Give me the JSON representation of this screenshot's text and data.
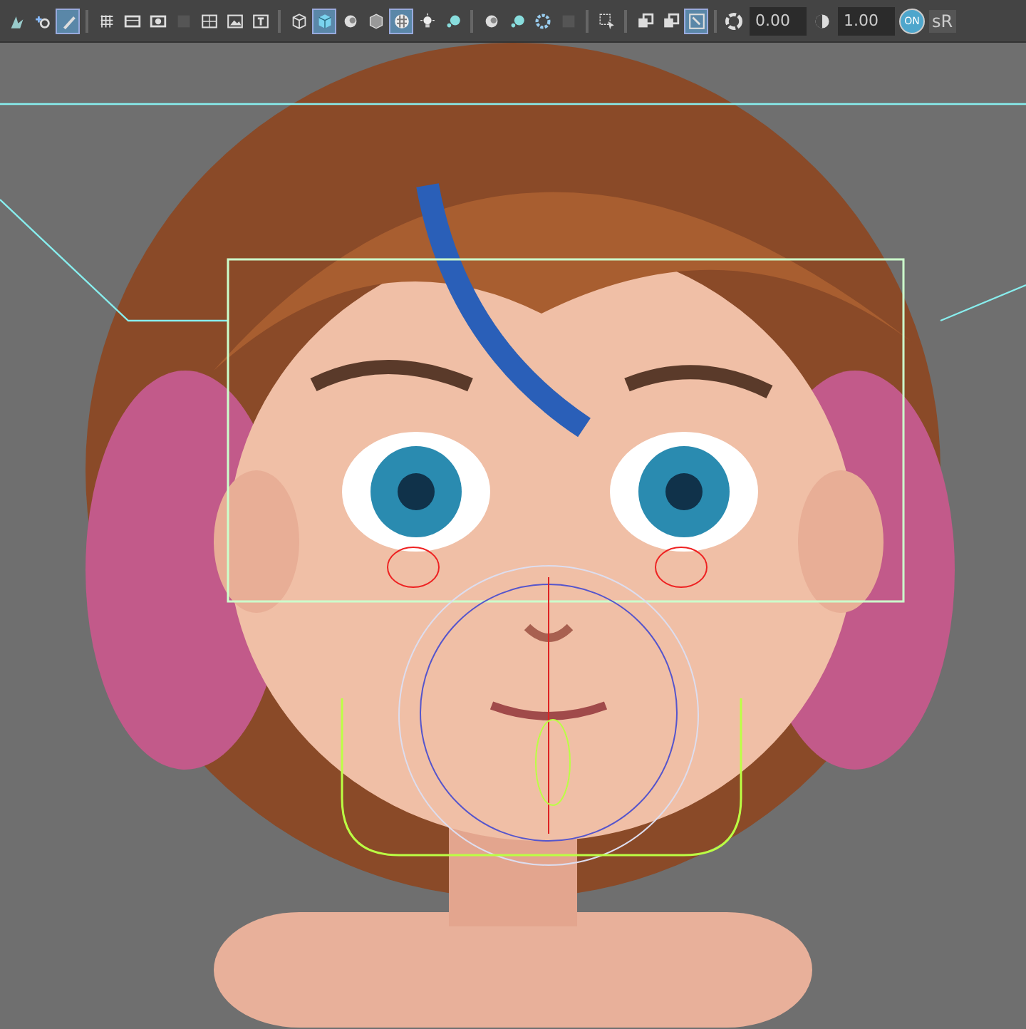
{
  "toolbar": {
    "groups": [
      [
        {
          "kind": "select",
          "selected": false
        },
        {
          "kind": "move",
          "selected": false
        },
        {
          "kind": "pencil",
          "selected": true
        }
      ],
      [
        {
          "kind": "grid",
          "selected": false
        },
        {
          "kind": "film",
          "selected": false
        },
        {
          "kind": "camera",
          "selected": false
        },
        {
          "kind": "blank",
          "selected": false
        },
        {
          "kind": "panels",
          "selected": false
        },
        {
          "kind": "image",
          "selected": false
        },
        {
          "kind": "text",
          "selected": false
        }
      ],
      [
        {
          "kind": "wire-cube",
          "selected": false
        },
        {
          "kind": "cube",
          "selected": true
        },
        {
          "kind": "sphere",
          "selected": false
        },
        {
          "kind": "textured-cube",
          "selected": false
        },
        {
          "kind": "checker",
          "selected": true
        },
        {
          "kind": "light",
          "selected": false
        },
        {
          "kind": "bubble",
          "selected": false
        }
      ],
      [
        {
          "kind": "sphere",
          "selected": false
        },
        {
          "kind": "bubble",
          "selected": false
        },
        {
          "kind": "ring",
          "selected": false
        },
        {
          "kind": "blank",
          "selected": false
        }
      ],
      [
        {
          "kind": "marquee",
          "selected": false
        }
      ],
      [
        {
          "kind": "layers",
          "selected": false
        },
        {
          "kind": "layers",
          "selected": false
        },
        {
          "kind": "frame",
          "selected": true
        }
      ]
    ],
    "exposure": "0.00",
    "gamma": "1.00",
    "color_management": {
      "label": "ON",
      "on": true
    },
    "color_space": "sR"
  }
}
